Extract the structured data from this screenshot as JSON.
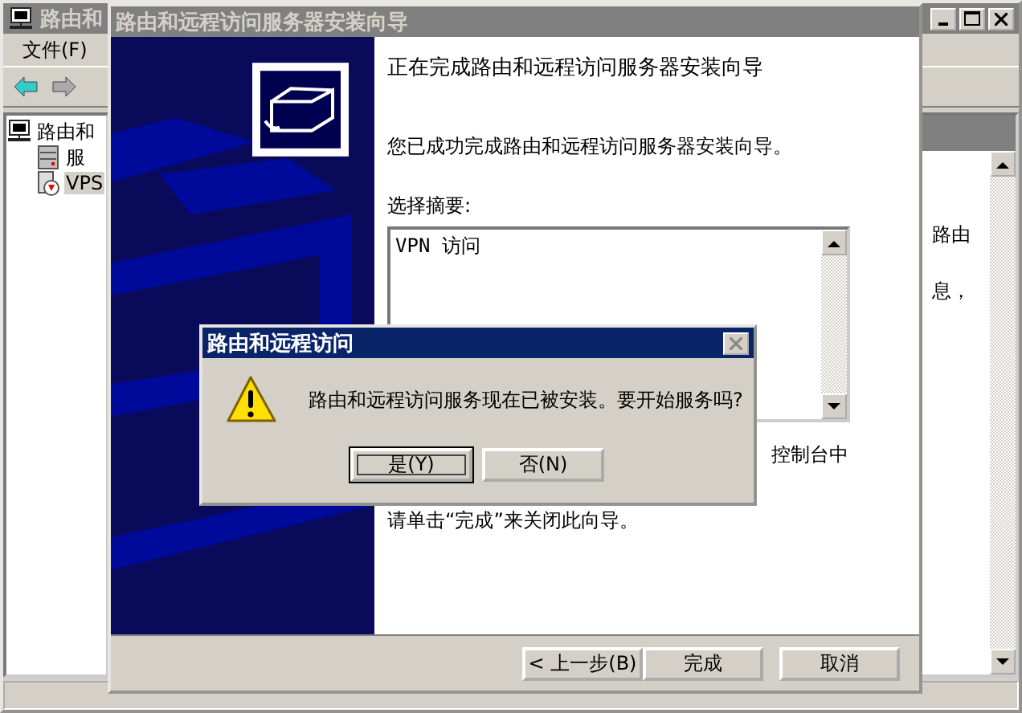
{
  "main_window": {
    "title": "路由和",
    "menu": [
      {
        "label": "文件(F)"
      }
    ],
    "tree": [
      {
        "label": "路由和",
        "selected": false,
        "children": [
          {
            "label": "服",
            "selected": false,
            "kind": "server"
          },
          {
            "label": "VPS",
            "selected": true,
            "kind": "server-down"
          }
        ]
      }
    ],
    "detail_text": [
      "路由",
      "息，"
    ]
  },
  "wizard": {
    "title": "路由和远程访问服务器安装向导",
    "heading": "正在完成路由和远程访问服务器安装向导",
    "message": "您已成功完成路由和远程访问服务器安装向导。",
    "summary_label": "选择摘要:",
    "summary": "VPN 访问",
    "note_partial": "控制台中",
    "finish_hint": "请单击“完成”来关闭此向导。",
    "buttons": [
      {
        "label": "< 上一步(B)"
      },
      {
        "label": "完成"
      },
      {
        "label": "取消"
      }
    ]
  },
  "dialog": {
    "title": "路由和远程访问",
    "message": "路由和远程访问服务现在已被安装。要开始服务吗?",
    "buttons": [
      {
        "label": "是(Y)",
        "focused": true
      },
      {
        "label": "否(N)",
        "focused": false
      }
    ]
  }
}
